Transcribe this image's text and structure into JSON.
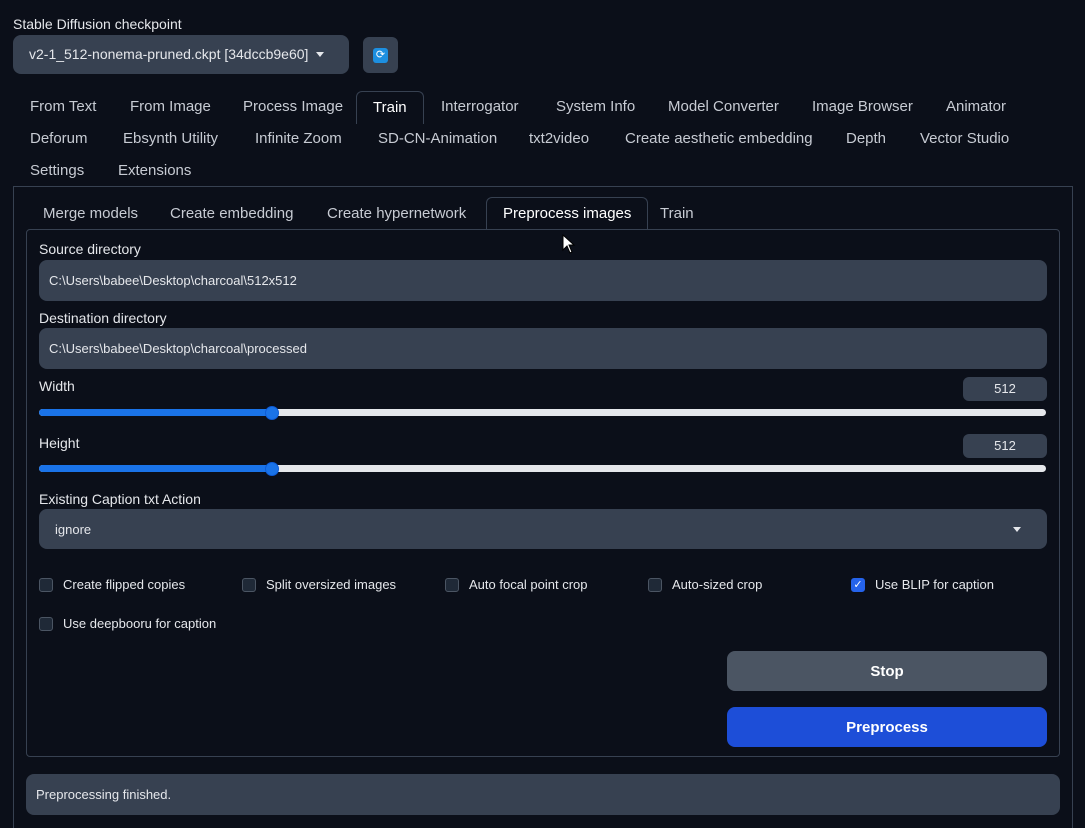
{
  "checkpoint": {
    "label": "Stable Diffusion checkpoint",
    "value": "v2-1_512-nonema-pruned.ckpt [34dccb9e60]",
    "refresh_icon": "refresh-icon"
  },
  "top_tabs": [
    "From Text",
    "From Image",
    "Process Image",
    "Train",
    "Interrogator",
    "System Info",
    "Model Converter",
    "Image Browser",
    "Animator",
    "Deforum",
    "Ebsynth Utility",
    "Infinite Zoom",
    "SD-CN-Animation",
    "txt2video",
    "Create aesthetic embedding",
    "Depth",
    "Vector Studio",
    "Settings",
    "Extensions"
  ],
  "active_top_tab": "Train",
  "sub_tabs": [
    "Merge models",
    "Create embedding",
    "Create hypernetwork",
    "Preprocess images",
    "Train"
  ],
  "active_sub_tab": "Preprocess images",
  "form": {
    "source_label": "Source directory",
    "source_value": "C:\\Users\\babee\\Desktop\\charcoal\\512x512",
    "dest_label": "Destination directory",
    "dest_value": "C:\\Users\\babee\\Desktop\\charcoal\\processed",
    "width_label": "Width",
    "width_value": "512",
    "width_fraction": 0.23,
    "height_label": "Height",
    "height_value": "512",
    "height_fraction": 0.23,
    "caption_action_label": "Existing Caption txt Action",
    "caption_action_value": "ignore",
    "checkboxes": [
      {
        "label": "Create flipped copies",
        "checked": false
      },
      {
        "label": "Split oversized images",
        "checked": false
      },
      {
        "label": "Auto focal point crop",
        "checked": false
      },
      {
        "label": "Auto-sized crop",
        "checked": false
      },
      {
        "label": "Use BLIP for caption",
        "checked": true
      },
      {
        "label": "Use deepbooru for caption",
        "checked": false
      }
    ]
  },
  "buttons": {
    "stop_label": "Stop",
    "preprocess_label": "Preprocess"
  },
  "status_text": "Preprocessing finished.",
  "colors": {
    "background": "#0b0f19",
    "input_bg": "#374151",
    "accent": "#1d4ed8",
    "slider": "#1a73e8"
  }
}
